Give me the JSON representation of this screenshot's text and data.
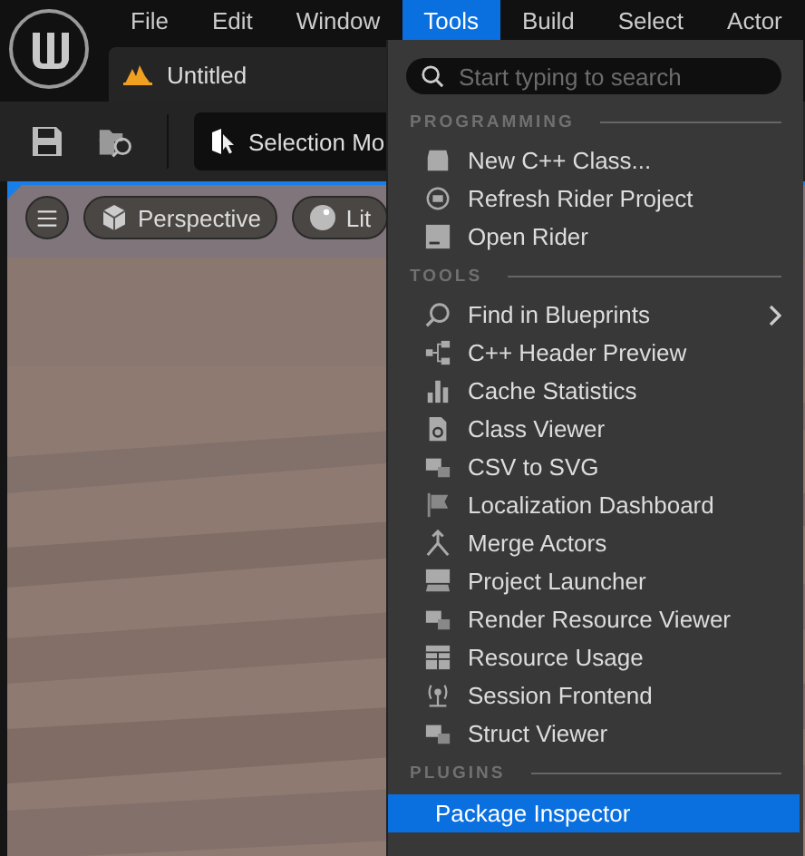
{
  "menubar": [
    {
      "label": "File",
      "selected": false
    },
    {
      "label": "Edit",
      "selected": false
    },
    {
      "label": "Window",
      "selected": false
    },
    {
      "label": "Tools",
      "selected": true
    },
    {
      "label": "Build",
      "selected": false
    },
    {
      "label": "Select",
      "selected": false
    },
    {
      "label": "Actor",
      "selected": false
    }
  ],
  "tab": {
    "title": "Untitled"
  },
  "toolbar": {
    "mode_button": "Selection Mo"
  },
  "viewport": {
    "view_mode": "Perspective",
    "lighting": "Lit"
  },
  "menu": {
    "search": {
      "placeholder": "Start typing to search"
    },
    "sections": [
      {
        "title": "PROGRAMMING",
        "items": [
          {
            "label": "New C++ Class...",
            "submenu": false,
            "selected": false
          },
          {
            "label": "Refresh Rider Project",
            "submenu": false,
            "selected": false
          },
          {
            "label": "Open Rider",
            "submenu": false,
            "selected": false
          }
        ]
      },
      {
        "title": "TOOLS",
        "items": [
          {
            "label": "Find in Blueprints",
            "submenu": true,
            "selected": false
          },
          {
            "label": "C++ Header Preview",
            "submenu": false,
            "selected": false
          },
          {
            "label": "Cache Statistics",
            "submenu": false,
            "selected": false
          },
          {
            "label": "Class Viewer",
            "submenu": false,
            "selected": false
          },
          {
            "label": "CSV to SVG",
            "submenu": false,
            "selected": false
          },
          {
            "label": "Localization Dashboard",
            "submenu": false,
            "selected": false
          },
          {
            "label": "Merge Actors",
            "submenu": false,
            "selected": false
          },
          {
            "label": "Project Launcher",
            "submenu": false,
            "selected": false
          },
          {
            "label": "Render Resource Viewer",
            "submenu": false,
            "selected": false
          },
          {
            "label": "Resource Usage",
            "submenu": false,
            "selected": false
          },
          {
            "label": "Session Frontend",
            "submenu": false,
            "selected": false
          },
          {
            "label": "Struct Viewer",
            "submenu": false,
            "selected": false
          }
        ]
      },
      {
        "title": "PLUGINS",
        "items": [
          {
            "label": "Package Inspector",
            "submenu": false,
            "selected": true
          }
        ]
      }
    ]
  }
}
